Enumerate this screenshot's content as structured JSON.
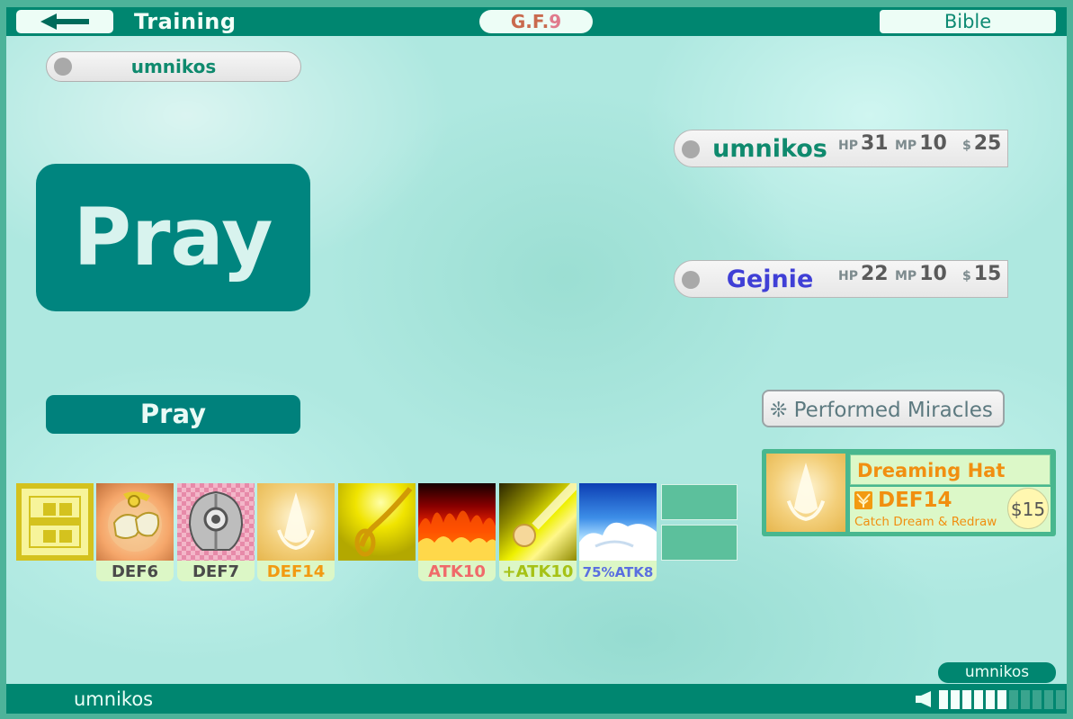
{
  "header": {
    "title": "Training",
    "gf_prefix": "G.F.",
    "gf_number": "9",
    "bible_label": "Bible"
  },
  "local_player": {
    "name": "umnikos"
  },
  "action": {
    "big_label": "Pray",
    "button_label": "Pray"
  },
  "players": [
    {
      "name": "umnikos",
      "hp": "31",
      "mp": "10",
      "money": "25",
      "color": "#0f8a6e"
    },
    {
      "name": "Gejnie",
      "hp": "22",
      "mp": "10",
      "money": "15",
      "color": "#3f3fd6"
    }
  ],
  "stat_labels": {
    "hp": "HP",
    "mp": "MP",
    "money": "$"
  },
  "miracles_label": "❊ Performed Miracles",
  "hand": [
    {
      "icon": "menu-icon",
      "label": ""
    },
    {
      "icon": "golden-gauntlets-icon",
      "label": "DEF6",
      "label_color": "#4a4a4a"
    },
    {
      "icon": "silver-helmet-icon",
      "label": "DEF7",
      "label_color": "#4a4a4a"
    },
    {
      "icon": "dreaming-hat-icon",
      "label": "DEF14",
      "label_color": "#f29a11"
    },
    {
      "icon": "golden-whip-icon",
      "label": ""
    },
    {
      "icon": "fire-icon",
      "label": "ATK10",
      "label_color": "#f06a6a"
    },
    {
      "icon": "meteor-icon",
      "label": "+ATK10",
      "label_color": "#a6c216"
    },
    {
      "icon": "cloud-icon",
      "label": "75%ATK8",
      "label_color": "#5a6fe0"
    }
  ],
  "detail": {
    "name": "Dreaming Hat",
    "stat": "DEF14",
    "effect": "Catch Dream & Redraw",
    "price": "$15"
  },
  "footer": {
    "player_tag": "umnikos",
    "name": "umnikos",
    "volume_level": 6,
    "volume_max": 11
  }
}
